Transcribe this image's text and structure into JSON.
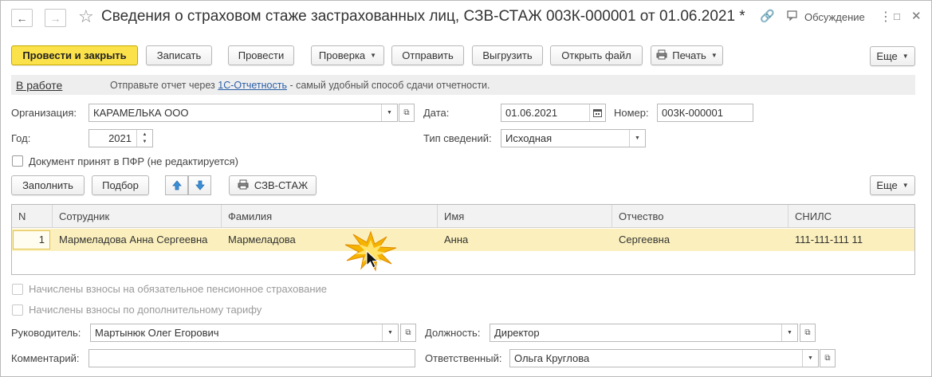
{
  "window": {
    "title": "Сведения о страховом стаже застрахованных лиц, СЗВ-СТАЖ 003К-000001 от 01.06.2021 *",
    "discussion_label": "Обсуждение"
  },
  "toolbar": {
    "post_close": "Провести и закрыть",
    "save": "Записать",
    "post": "Провести",
    "check": "Проверка",
    "send": "Отправить",
    "export": "Выгрузить",
    "open_file": "Открыть файл",
    "print": "Печать",
    "more": "Еще"
  },
  "infobar": {
    "status": "В работе",
    "text_before": "Отправьте отчет через ",
    "link": "1С-Отчетность",
    "text_after": " - самый удобный способ сдачи отчетности."
  },
  "form": {
    "org_label": "Организация:",
    "org_value": "КАРАМЕЛЬКА ООО",
    "date_label": "Дата:",
    "date_value": "01.06.2021",
    "number_label": "Номер:",
    "number_value": "003К-000001",
    "year_label": "Год:",
    "year_value": "2021",
    "type_label": "Тип сведений:",
    "type_value": "Исходная",
    "accepted_label": "Документ принят в ПФР (не редактируется)"
  },
  "table_toolbar": {
    "fill": "Заполнить",
    "select": "Подбор",
    "print_szv": "СЗВ-СТАЖ",
    "more": "Еще"
  },
  "table": {
    "columns": [
      "N",
      "Сотрудник",
      "Фамилия",
      "Имя",
      "Отчество",
      "СНИЛС"
    ],
    "rows": [
      {
        "n": "1",
        "employee": "Мармеладова Анна Сергеевна",
        "last": "Мармеладова",
        "first": "Анна",
        "middle": "Сергеевна",
        "snils": "111-111-111 11"
      }
    ]
  },
  "options": {
    "pension_label": "Начислены взносы на обязательное пенсионное страхование",
    "extra_label": "Начислены взносы по дополнительному тарифу"
  },
  "footer": {
    "head_label": "Руководитель:",
    "head_value": "Мартынюк Олег Егорович",
    "position_label": "Должность:",
    "position_value": "Директор",
    "comment_label": "Комментарий:",
    "comment_value": "",
    "responsible_label": "Ответственный:",
    "responsible_value": "Ольга Круглова"
  },
  "colors": {
    "primary_button": "#fce24a",
    "selected_row": "#fbf0bd",
    "link": "#2c5fa8"
  }
}
